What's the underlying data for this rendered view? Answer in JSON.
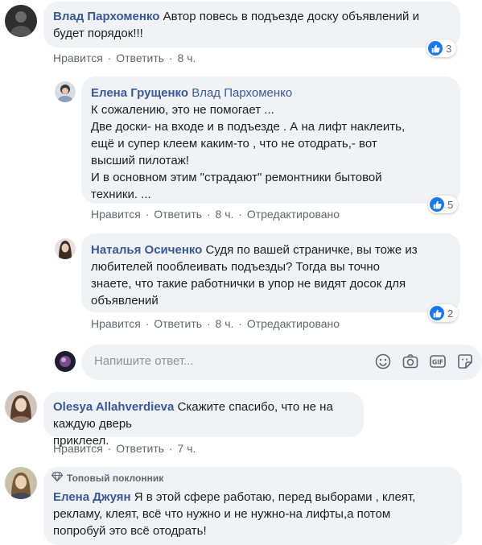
{
  "comments": [
    {
      "author": "Влад Пархоменко",
      "text_lines": [
        "Автор повесь в подъезде доску объявлений и",
        "будет порядок!!!"
      ],
      "like": "Нравится",
      "reply": "Ответить",
      "time": "8 ч.",
      "reactions": "3"
    },
    {
      "author": "Елена Грущенко",
      "mention": "Влад Пархоменко",
      "text_lines": [
        "К сожалению, это не помогает ...",
        "Две доски- на входе и в подъезде . А на лифт наклеить,",
        "ещё и супер клеем каким-то , что не отодрать,- вот",
        "высший пилотаж!",
        "И в основном этим \"страдают\" ремонтники бытовой",
        "техники. ..."
      ],
      "like": "Нравится",
      "reply": "Ответить",
      "time": "8 ч.",
      "edited": "Отредактировано",
      "reactions": "5"
    },
    {
      "author": "Наталья Осиченко",
      "text_lines": [
        "Судя по вашей страничке, вы тоже из",
        "любителей пооблеивать подъезды? Тогда вы точно",
        "знаете, что такие работнички в упор не видят досок для",
        "объявлений"
      ],
      "like": "Нравится",
      "reply": "Ответить",
      "time": "8 ч.",
      "edited": "Отредактировано",
      "reactions": "2"
    },
    {
      "author": "Olesya Allahverdieva",
      "text_lines": [
        "Скажите спасибо, что не на каждую дверь",
        "приклеел."
      ],
      "like": "Нравится",
      "reply": "Ответить",
      "time": "7 ч."
    },
    {
      "badge": "Топовый поклонник",
      "author": "Елена Джуян",
      "text_lines": [
        "Я в этой сфере работаю, перед выборами , клеят,",
        "рекламу, клеят, всё что нужно и не нужно-на лифты,а потом",
        "попробуй это всё отодрать!"
      ]
    }
  ],
  "reply_box": {
    "placeholder": "Напишите ответ...",
    "icons": [
      "emoji-icon",
      "camera-icon",
      "gif-icon",
      "sticker-icon"
    ]
  },
  "colors": {
    "name": "#385898",
    "bubble": "#f0f2f5",
    "meta": "#606770",
    "like_blue": "#1877f2"
  }
}
